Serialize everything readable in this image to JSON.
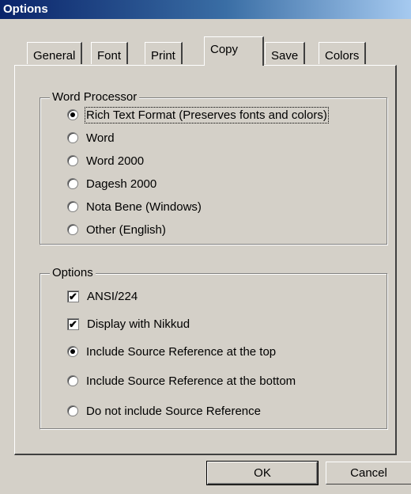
{
  "window": {
    "title": "Options"
  },
  "tabs": [
    {
      "label": "General",
      "active": false
    },
    {
      "label": "Font",
      "active": false
    },
    {
      "label": "Print",
      "active": false
    },
    {
      "label": "Copy",
      "active": true
    },
    {
      "label": "Save",
      "active": false
    },
    {
      "label": "Colors",
      "active": false
    }
  ],
  "word_processor": {
    "legend": "Word Processor",
    "options": [
      {
        "label": "Rich Text Format (Preserves fonts and colors)",
        "checked": true
      },
      {
        "label": "Word",
        "checked": false
      },
      {
        "label": "Word 2000",
        "checked": false
      },
      {
        "label": "Dagesh 2000",
        "checked": false
      },
      {
        "label": "Nota Bene (Windows)",
        "checked": false
      },
      {
        "label": "Other (English)",
        "checked": false
      }
    ]
  },
  "options_group": {
    "legend": "Options",
    "checkboxes": [
      {
        "label": "ANSI/224",
        "checked": true
      },
      {
        "label": "Display with Nikkud",
        "checked": true
      }
    ],
    "source_reference": [
      {
        "label": "Include Source Reference at the top",
        "checked": true
      },
      {
        "label": "Include Source Reference at the bottom",
        "checked": false
      },
      {
        "label": "Do not include Source Reference",
        "checked": false
      }
    ]
  },
  "buttons": {
    "ok": "OK",
    "cancel": "Cancel"
  }
}
